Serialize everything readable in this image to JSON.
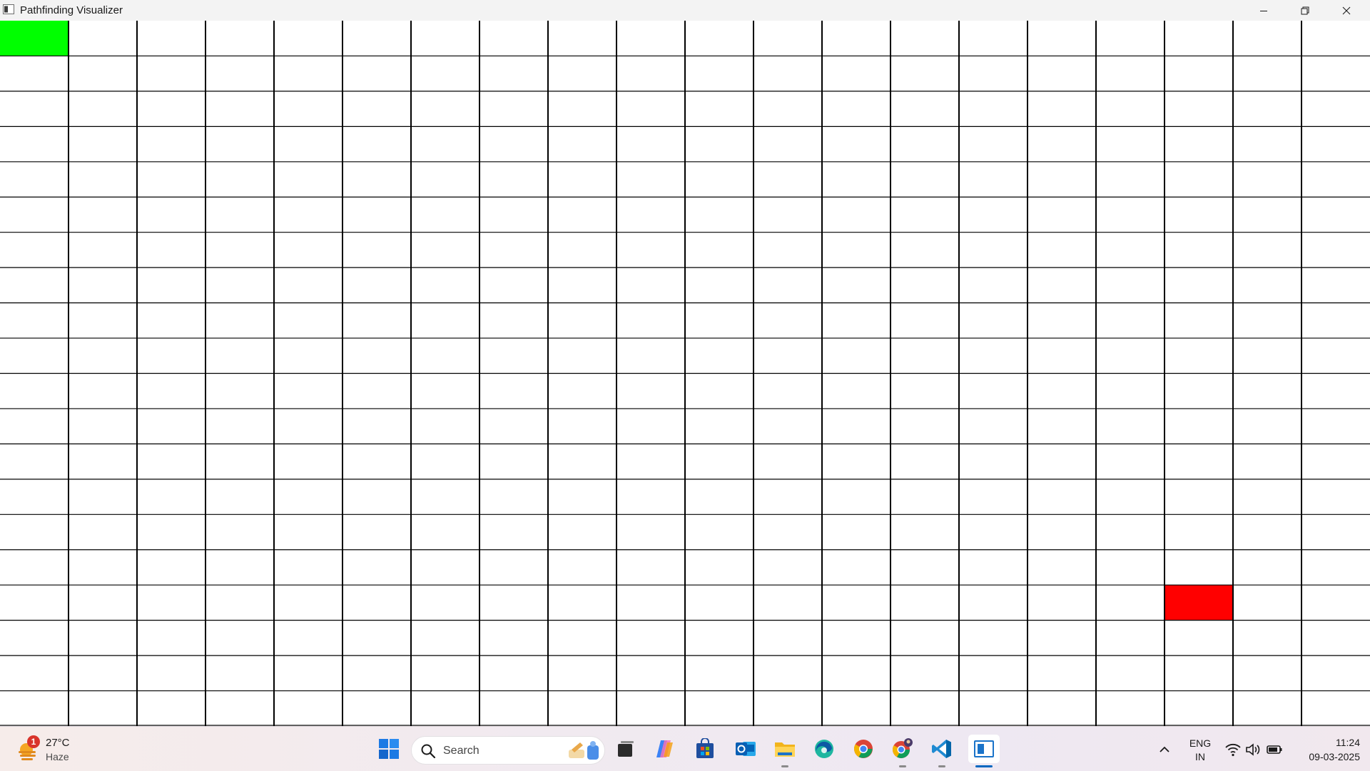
{
  "window": {
    "title": "Pathfinding Visualizer",
    "controls": {
      "minimize": "minimize-icon",
      "maximize": "restore-icon",
      "close": "close-icon"
    }
  },
  "grid": {
    "rows": 20,
    "cols": 20,
    "start": {
      "row": 0,
      "col": 0
    },
    "end": {
      "row": 16,
      "col": 17
    },
    "colors": {
      "start": "#00ff00",
      "end": "#ff0000",
      "line": "#000000",
      "empty": "#ffffff"
    }
  },
  "taskbar": {
    "weather": {
      "temp": "27°C",
      "condition": "Haze",
      "badge": "1",
      "icon": "sun-haze-icon"
    },
    "search": {
      "label": "Search",
      "icon": "search-icon"
    },
    "apps": [
      {
        "name": "start-button",
        "icon": "windows-logo-icon"
      },
      {
        "name": "task-view",
        "icon": "task-view-icon"
      },
      {
        "name": "copilot",
        "icon": "copilot-icon"
      },
      {
        "name": "microsoft-store",
        "icon": "store-icon"
      },
      {
        "name": "outlook",
        "icon": "outlook-icon"
      },
      {
        "name": "file-explorer",
        "icon": "folder-icon"
      },
      {
        "name": "edge",
        "icon": "edge-icon"
      },
      {
        "name": "chrome",
        "icon": "chrome-icon"
      },
      {
        "name": "chrome-profile",
        "icon": "chrome-profile-icon"
      },
      {
        "name": "vscode",
        "icon": "vscode-icon"
      },
      {
        "name": "pathfinding-visualizer",
        "icon": "app-window-icon"
      }
    ],
    "tray": {
      "lang_line1": "ENG",
      "lang_line2": "IN",
      "time": "11:24",
      "date": "09-03-2025",
      "icons": [
        "chevron-up-icon",
        "wifi-icon",
        "volume-icon",
        "battery-icon"
      ]
    },
    "accent": "#0067c0"
  }
}
